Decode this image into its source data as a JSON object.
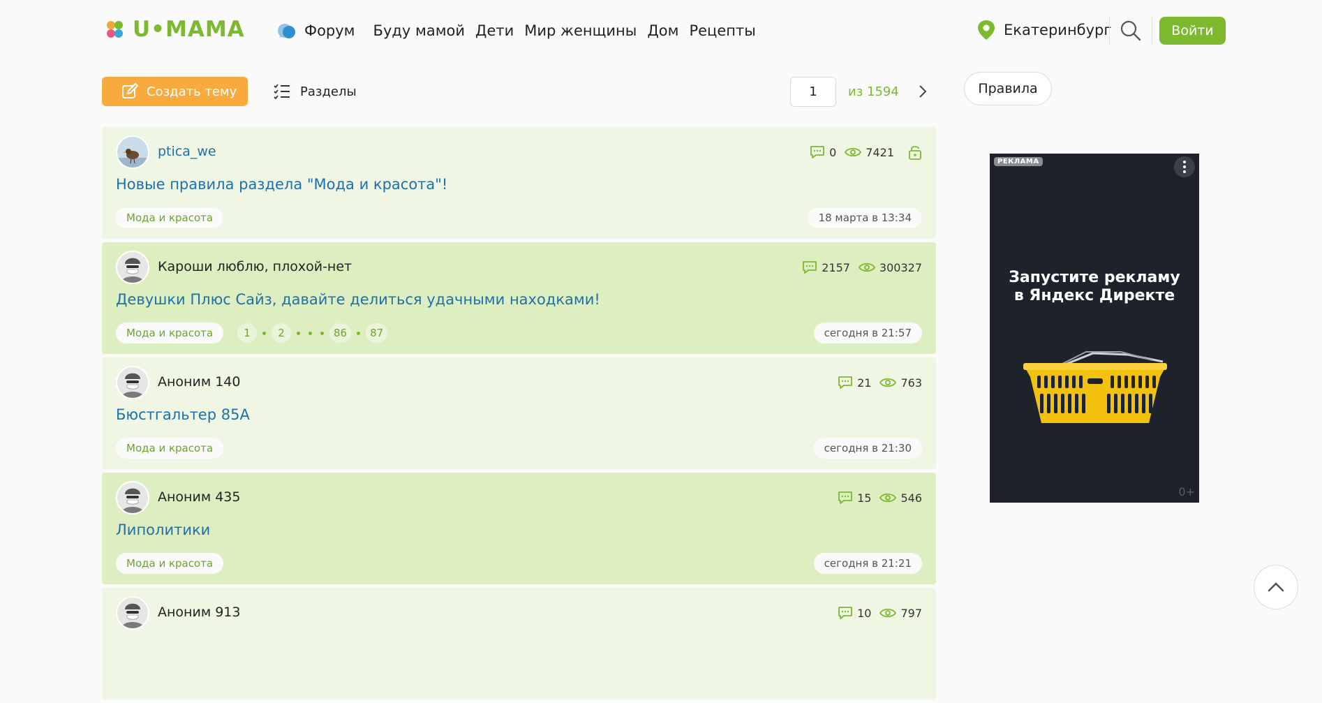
{
  "header": {
    "logo_text": "U•MAMA",
    "nav": [
      {
        "label": "Форум",
        "icon": "forum-icon"
      },
      {
        "label": "Буду мамой"
      },
      {
        "label": "Дети"
      },
      {
        "label": "Мир женщины"
      },
      {
        "label": "Дом"
      },
      {
        "label": "Рецепты"
      }
    ],
    "city": "Екатеринбург",
    "login_label": "Войти"
  },
  "toolbar": {
    "create_label": "Создать тему",
    "sections_label": "Разделы",
    "page_value": "1",
    "page_total": "из 1594"
  },
  "sidebar": {
    "rules_label": "Правила",
    "ad": {
      "badge": "РЕКЛАМА",
      "line1": "Запустите рекламу",
      "line2": "в Яндекс Директе",
      "age": "0+"
    }
  },
  "topics": [
    {
      "author": "ptica_we",
      "comments": "0",
      "views": "7421",
      "locked": true,
      "title": "Новые правила раздела \"Мода и красота\"!",
      "tag": "Мода и красота",
      "date": "18 марта в 13:34"
    },
    {
      "author": "Кароши люблю, плохой-нет",
      "comments": "2157",
      "views": "300327",
      "title": "Девушки Плюс Сайз, давайте делиться удачными находками!",
      "tag": "Мода и красота",
      "pages": [
        "1",
        "2",
        "86",
        "87"
      ],
      "date": "сегодня в 21:57"
    },
    {
      "author": "Аноним 140",
      "comments": "21",
      "views": "763",
      "title": "Бюстгальтер 85А",
      "tag": "Мода и красота",
      "date": "сегодня в 21:30"
    },
    {
      "author": "Аноним 435",
      "comments": "15",
      "views": "546",
      "title": "Липолитики",
      "tag": "Мода и красота",
      "date": "сегодня в 21:21"
    },
    {
      "author": "Аноним 913",
      "comments": "10",
      "views": "797"
    }
  ],
  "colors": {
    "brand_green": "#7cb92f",
    "create_orange": "#f8ab3c",
    "link_blue": "#1f70a8",
    "topic_light": "#eff6e3",
    "topic_dark": "#ddefc0"
  }
}
